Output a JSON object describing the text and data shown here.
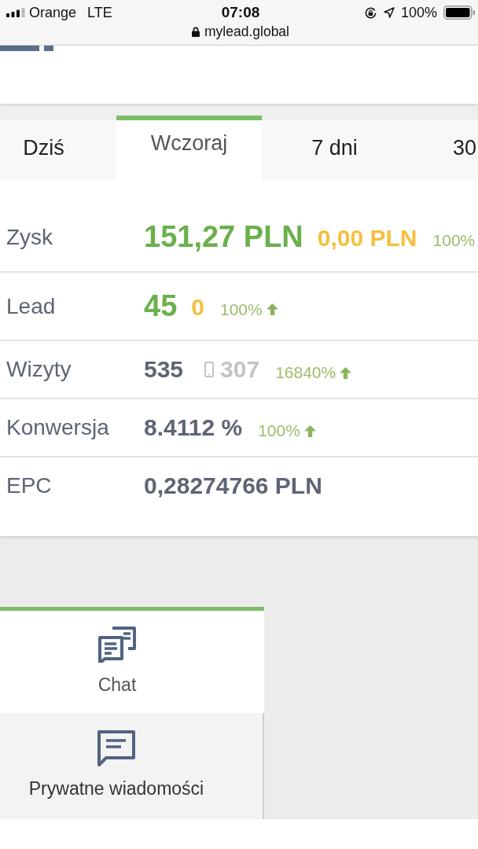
{
  "status_bar": {
    "carrier": "Orange",
    "network": "LTE",
    "time": "07:08",
    "battery": "100%",
    "url": "mylead.global"
  },
  "period_tabs": [
    {
      "label": "Dziś",
      "selected": false
    },
    {
      "label": "Wczoraj",
      "selected": true
    },
    {
      "label": "7 dni",
      "selected": false
    },
    {
      "label": "30",
      "selected": false
    }
  ],
  "stats": [
    {
      "label": "Zysk",
      "value": {
        "kind": "highlight",
        "text": "151,27 PLN",
        "color": "#6ab04c"
      },
      "secondary": {
        "kind": "pending",
        "text": "0,00 PLN",
        "color": "#f4c03e"
      },
      "change": {
        "text": "100%",
        "arrow": false
      }
    },
    {
      "label": "Lead",
      "value": {
        "kind": "highlight",
        "text": "45",
        "color": "#6ab04c"
      },
      "secondary": {
        "kind": "pending",
        "text": "0",
        "color": "#f4c03e"
      },
      "change": {
        "text": "100%",
        "arrow": true
      }
    },
    {
      "label": "Wizyty",
      "value": {
        "kind": "plain",
        "text": "535",
        "color": "#5e6573"
      },
      "secondary": {
        "kind": "mobile",
        "text": "307",
        "color": "#c4c4c4"
      },
      "change": {
        "text": "16840%",
        "arrow": true
      }
    },
    {
      "label": "Konwersja",
      "value": {
        "kind": "plain",
        "text": "8.4112 %",
        "color": "#5e6573"
      },
      "change": {
        "text": "100%",
        "arrow": true
      }
    },
    {
      "label": "EPC",
      "value": {
        "kind": "plain",
        "text": "0,28274766 PLN",
        "color": "#5e6573"
      }
    }
  ],
  "message_tabs": [
    {
      "kind": "chats",
      "label": "Chat",
      "selected": true
    },
    {
      "kind": "message",
      "label": "Prywatne wiadomości",
      "selected": false
    }
  ]
}
